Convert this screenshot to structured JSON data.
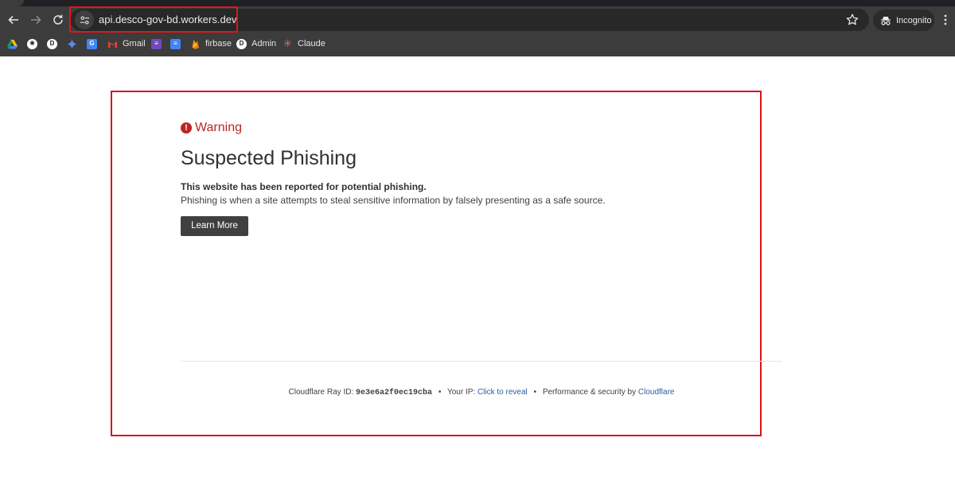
{
  "browser": {
    "url": "api.desco-gov-bd.workers.dev",
    "profile_label": "Incognito",
    "bookmarks": [
      {
        "icon": "drive-icon",
        "label": ""
      },
      {
        "icon": "chatgpt-icon",
        "label": ""
      },
      {
        "icon": "site-icon",
        "label": ""
      },
      {
        "icon": "gemini-icon",
        "label": ""
      },
      {
        "icon": "translate-icon",
        "label": ""
      },
      {
        "icon": "gmail-icon",
        "label": "Gmail"
      },
      {
        "icon": "forms-icon",
        "label": ""
      },
      {
        "icon": "docs-icon",
        "label": ""
      },
      {
        "icon": "firebase-icon",
        "label": "firbase"
      },
      {
        "icon": "admin-icon",
        "label": "Admin"
      },
      {
        "icon": "claude-icon",
        "label": "Claude"
      }
    ]
  },
  "page": {
    "warning_label": "Warning",
    "warning_icon": "!",
    "headline": "Suspected Phishing",
    "reported_text": "This website has been reported for potential phishing.",
    "explanation": "Phishing is when a site attempts to steal sensitive information by falsely presenting as a safe source.",
    "learn_more_label": "Learn More",
    "footer": {
      "ray_prefix": "Cloudflare Ray ID:",
      "ray_id": "9e3e6a2f0ec19cba",
      "separator": "•",
      "ip_prefix": "Your IP:",
      "ip_link": "Click to reveal",
      "perf_prefix": "Performance & security by",
      "perf_link": "Cloudflare"
    }
  },
  "colors": {
    "warning": "#bd2426",
    "highlight_box": "#d7141b",
    "button_bg": "#404040",
    "link": "#2c5ea0"
  }
}
